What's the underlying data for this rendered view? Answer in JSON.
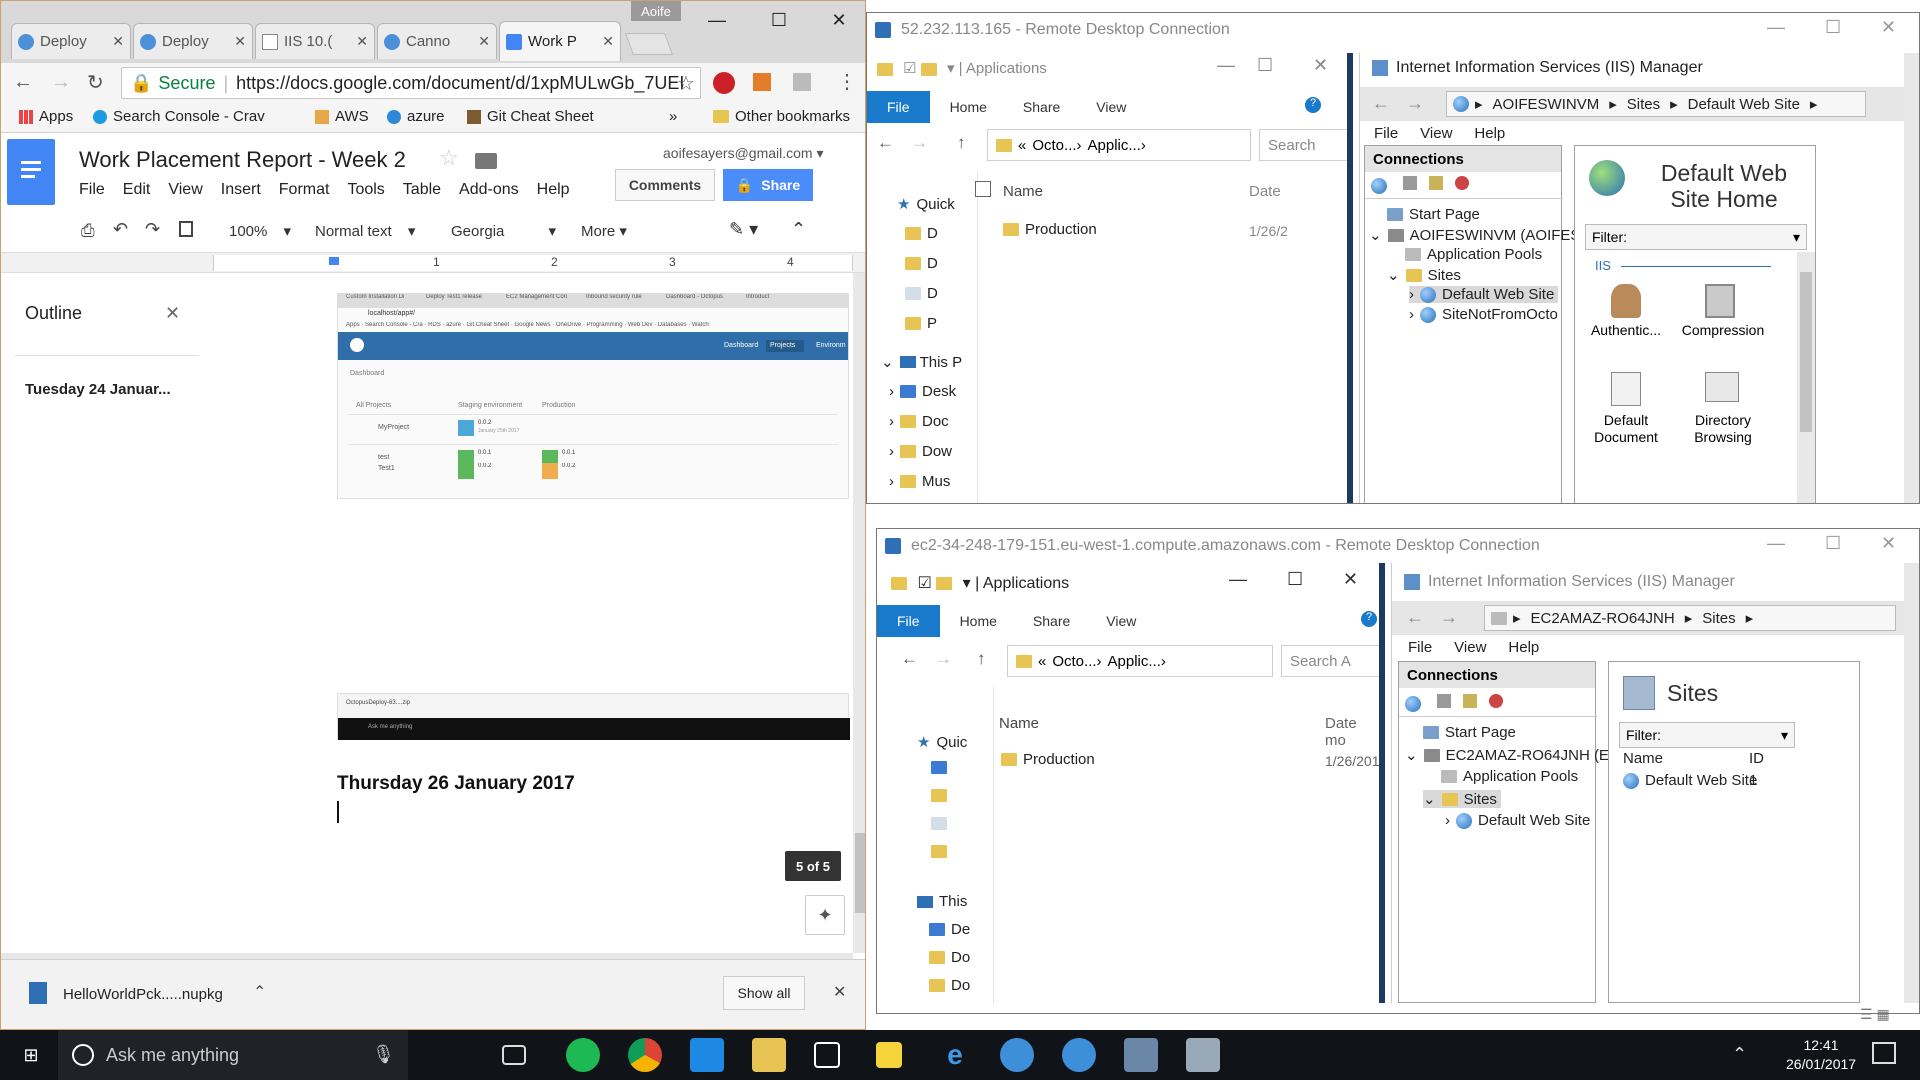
{
  "chrome": {
    "tabs": [
      {
        "label": "Deploy"
      },
      {
        "label": "Deploy"
      },
      {
        "label": "IIS 10.("
      },
      {
        "label": "Canno"
      },
      {
        "label": "Work P"
      }
    ],
    "user": "Aoife",
    "security_label": "Secure",
    "url": "https://docs.google.com/document/d/1xpMULwGb_7UEI",
    "bookmarks": [
      "Apps",
      "Search Console - Crav",
      "AWS",
      "azure",
      "Git Cheat Sheet",
      "Other bookmarks"
    ],
    "bookmark_overflow": "»"
  },
  "docs": {
    "title": "Work Placement Report - Week 2",
    "account": "aoifesayers@gmail.com",
    "menu": [
      "File",
      "Edit",
      "View",
      "Insert",
      "Format",
      "Tools",
      "Table",
      "Add-ons",
      "Help"
    ],
    "comments_label": "Comments",
    "share_label": "Share",
    "zoom": "100%",
    "style": "Normal text",
    "font": "Georgia",
    "more": "More",
    "ruler_marks": [
      "1",
      "2",
      "3",
      "4"
    ],
    "outline_title": "Outline",
    "outline_items": [
      "Tuesday 24 Januar..."
    ],
    "heading": "Thursday 26 January 2017",
    "page_counter": "5 of 5",
    "screenshot": {
      "tabs": [
        "Custom Installation Di",
        "Deploy Test1 release",
        "EC2 Management Con",
        "Inbound security rule",
        "Dashboard - Octopus",
        "Introduct"
      ],
      "url": "localhost/app#/",
      "bookmarks": [
        "Apps",
        "Search Console - Cra",
        "RDS",
        "azure",
        "Git Cheat Sheet",
        "Google News",
        "OneDrive",
        "Programming",
        "Web Dev",
        "Databases",
        "Watch"
      ],
      "nav": [
        "Dashboard",
        "Projects",
        "Environm"
      ],
      "dashboard_label": "Dashboard",
      "columns": [
        "All Projects",
        "Staging environment",
        "Production"
      ],
      "rows": [
        {
          "name": "MyProject",
          "staging": "0.0.2",
          "staging_date": "January 25th 2017",
          "prod": "",
          "prod_date": ""
        },
        {
          "name": "test",
          "staging": "0.0.1",
          "staging_date": "January 24th 2017",
          "prod": "0.0.1",
          "prod_date": "January 24th 2017"
        },
        {
          "name": "Test1",
          "staging": "0.0.2",
          "staging_date": "January 25th 2017",
          "prod": "0.0.2",
          "prod_date": "January 25th 2017"
        }
      ],
      "download": "OctopusDeploy-63....zip",
      "search": "Ask me anything"
    },
    "download_file": "HelloWorldPck.....nupkg",
    "show_all": "Show all"
  },
  "rdp1": {
    "title": "52.232.113.165 - Remote Desktop Connection",
    "explorer": {
      "title": "Applications",
      "ribbon": [
        "File",
        "Home",
        "Share",
        "View"
      ],
      "path": [
        "«",
        "Octo...",
        "Applic..."
      ],
      "search": "Search",
      "col_name": "Name",
      "col_date": "Date",
      "folder": "Production",
      "date": "1/26/2",
      "tree": [
        "Quick",
        "D",
        "D",
        "D",
        "P",
        "This P",
        "Desk",
        "Doc",
        "Dow",
        "Mus"
      ]
    },
    "iis": {
      "title": "Internet Information Services (IIS) Manager",
      "crumbs": [
        "AOIFESWINVM",
        "Sites",
        "Default Web Site"
      ],
      "menu": [
        "File",
        "View",
        "Help"
      ],
      "connections": "Connections",
      "tree": [
        "Start Page",
        "AOIFESWINVM (AOIFESWINV",
        "Application Pools",
        "Sites",
        "Default Web Site",
        "SiteNotFromOcto"
      ],
      "home_title": "Default Web Site Home",
      "filter": "Filter:",
      "group": "IIS",
      "features": [
        "Authentic...",
        "Compression",
        "Default Document",
        "Directory Browsing"
      ]
    }
  },
  "rdp2": {
    "title": "ec2-34-248-179-151.eu-west-1.compute.amazonaws.com - Remote Desktop Connection",
    "explorer": {
      "title": "Applications",
      "ribbon": [
        "File",
        "Home",
        "Share",
        "View"
      ],
      "path": [
        "Octo...",
        "Applic..."
      ],
      "search": "Search A",
      "col_name": "Name",
      "col_date": "Date mo",
      "folder": "Production",
      "date": "1/26/201",
      "tree": [
        "Quic",
        "This",
        "De",
        "Do",
        "Do"
      ]
    },
    "iis": {
      "title": "Internet Information Services (IIS) Manager",
      "crumbs": [
        "EC2AMAZ-RO64JNH",
        "Sites"
      ],
      "menu": [
        "File",
        "View",
        "Help"
      ],
      "connections": "Connections",
      "tree": [
        "Start Page",
        "EC2AMAZ-RO64JNH (EC2AM",
        "Application Pools",
        "Sites",
        "Default Web Site"
      ],
      "sites_title": "Sites",
      "filter": "Filter:",
      "col_name": "Name",
      "col_id": "ID",
      "site_name": "Default Web Site",
      "site_id": "1"
    }
  },
  "taskbar": {
    "search": "Ask me anything",
    "time": "12:41",
    "date": "26/01/2017"
  }
}
